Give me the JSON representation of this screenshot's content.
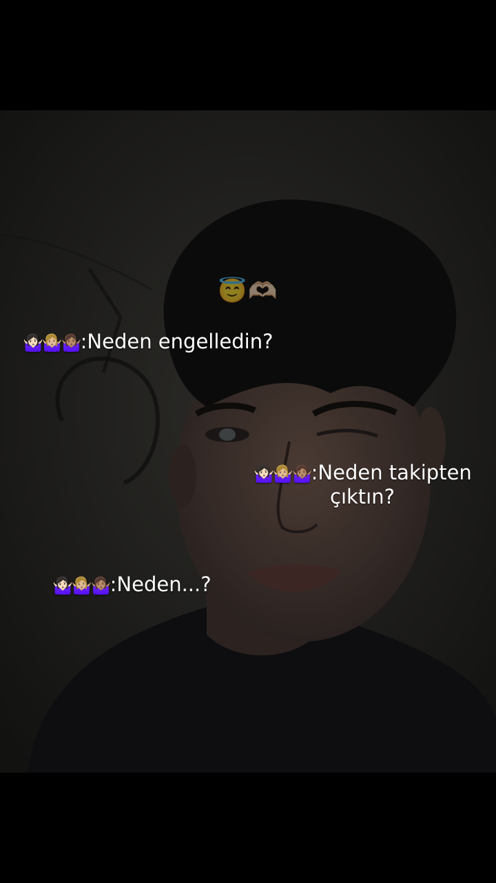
{
  "top_emojis": "😇🫶🏻",
  "captions": [
    {
      "emojis": "🤷🏻‍♀️🤷🏼‍♀️🤷🏽‍♀️",
      "text": ":Neden engelledin?"
    },
    {
      "emojis": "🤷🏻‍♀️🤷🏼‍♀️🤷🏽‍♀️",
      "text": ":Neden takipten",
      "text2": "çıktın?"
    },
    {
      "emojis": "🤷🏻‍♀️🤷🏼‍♀️🤷🏽‍♀️",
      "text": ":Neden...?"
    }
  ]
}
